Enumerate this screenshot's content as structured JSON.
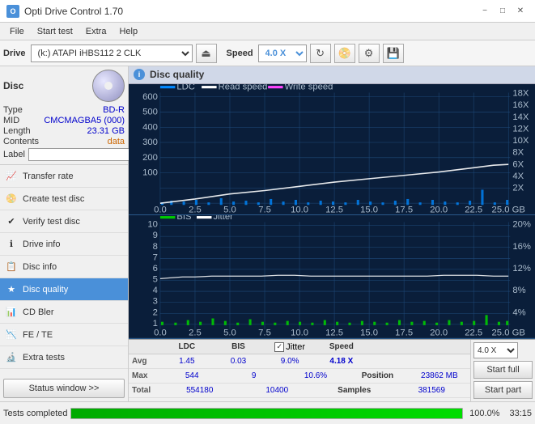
{
  "titleBar": {
    "title": "Opti Drive Control 1.70",
    "icon": "O",
    "controls": [
      "−",
      "□",
      "✕"
    ]
  },
  "menuBar": {
    "items": [
      "File",
      "Start test",
      "Extra",
      "Help"
    ]
  },
  "toolbar": {
    "driveLabel": "Drive",
    "driveValue": "(k:) ATAPI iHBS112  2 CLK",
    "ejectIcon": "⏏",
    "speedLabel": "Speed",
    "speedValue": "4.0 X",
    "icons": [
      "🔄",
      "💿",
      "⚙",
      "💾"
    ]
  },
  "sidebar": {
    "discLabel": "Disc",
    "discFields": [
      {
        "label": "Type",
        "value": "BD-R",
        "class": "blue"
      },
      {
        "label": "MID",
        "value": "CMCMAGBA5 (000)",
        "class": "blue"
      },
      {
        "label": "Length",
        "value": "23.31 GB",
        "class": "blue"
      },
      {
        "label": "Contents",
        "value": "data",
        "class": "data"
      },
      {
        "label": "Label",
        "value": "",
        "class": ""
      }
    ],
    "navItems": [
      {
        "label": "Transfer rate",
        "icon": "📈",
        "active": false
      },
      {
        "label": "Create test disc",
        "icon": "📀",
        "active": false
      },
      {
        "label": "Verify test disc",
        "icon": "✔",
        "active": false
      },
      {
        "label": "Drive info",
        "icon": "ℹ",
        "active": false
      },
      {
        "label": "Disc info",
        "icon": "📋",
        "active": false
      },
      {
        "label": "Disc quality",
        "icon": "★",
        "active": true
      },
      {
        "label": "CD Bler",
        "icon": "📊",
        "active": false
      },
      {
        "label": "FE / TE",
        "icon": "📉",
        "active": false
      },
      {
        "label": "Extra tests",
        "icon": "🔬",
        "active": false
      }
    ],
    "statusButton": "Status window >>"
  },
  "discQuality": {
    "title": "Disc quality",
    "icon": "i",
    "chart1": {
      "legend": [
        {
          "label": "LDC",
          "color": "#00aaff"
        },
        {
          "label": "Read speed",
          "color": "#ffffff"
        },
        {
          "label": "Write speed",
          "color": "#ff44ff"
        }
      ],
      "yAxisLeft": [
        600,
        500,
        400,
        300,
        200,
        100
      ],
      "yAxisRight": [
        "18X",
        "16X",
        "14X",
        "12X",
        "10X",
        "8X",
        "6X",
        "4X",
        "2X"
      ],
      "xAxis": [
        "0.0",
        "2.5",
        "5.0",
        "7.5",
        "10.0",
        "12.5",
        "15.0",
        "17.5",
        "20.0",
        "22.5",
        "25.0 GB"
      ]
    },
    "chart2": {
      "legend": [
        {
          "label": "BIS",
          "color": "#00ff00"
        },
        {
          "label": "Jitter",
          "color": "#ffffff"
        }
      ],
      "yAxisLeft": [
        10,
        9,
        8,
        7,
        6,
        5,
        4,
        3,
        2,
        1
      ],
      "yAxisRight": [
        "20%",
        "16%",
        "12%",
        "8%",
        "4%"
      ],
      "xAxis": [
        "0.0",
        "2.5",
        "5.0",
        "7.5",
        "10.0",
        "12.5",
        "15.0",
        "17.5",
        "20.0",
        "22.5",
        "25.0 GB"
      ]
    },
    "stats": {
      "headers": [
        "",
        "LDC",
        "BIS",
        "",
        "Jitter",
        "Speed",
        "",
        ""
      ],
      "rows": [
        {
          "label": "Avg",
          "ldc": "1.45",
          "bis": "0.03",
          "jitter": "9.0%",
          "speed": "4.18 X",
          "position": ""
        },
        {
          "label": "Max",
          "ldc": "544",
          "bis": "9",
          "jitter": "10.6%",
          "position": "23862 MB"
        },
        {
          "label": "Total",
          "ldc": "554180",
          "bis": "10400",
          "samples": "381569"
        }
      ],
      "speedCombo": "4.0 X",
      "startFull": "Start full",
      "startPart": "Start part",
      "jitterChecked": true,
      "positionLabel": "Position",
      "samplesLabel": "Samples"
    }
  },
  "statusBar": {
    "text": "Tests completed",
    "progress": 100,
    "progressText": "100.0%",
    "time": "33:15"
  }
}
